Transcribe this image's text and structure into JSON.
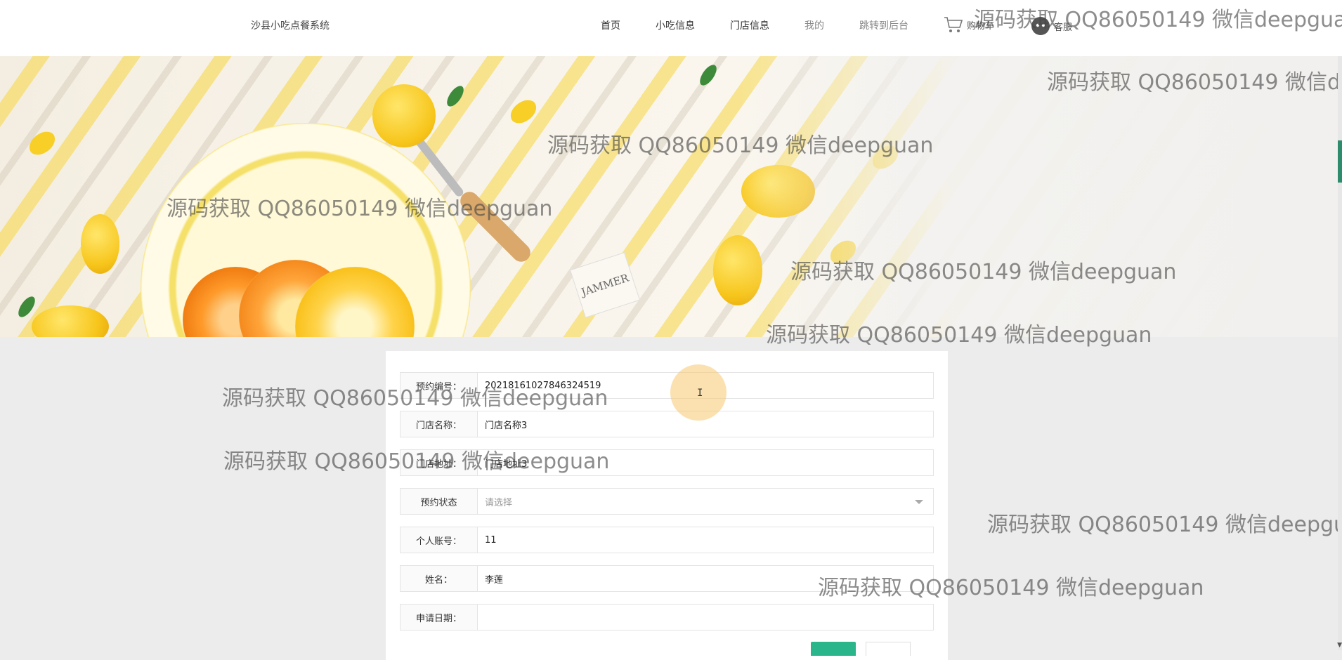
{
  "header": {
    "brand": "沙县小吃点餐系统",
    "nav": [
      "首页",
      "小吃信息",
      "门店信息",
      "我的",
      "跳转到后台"
    ],
    "cart_label": "购物车",
    "service_label": "客服"
  },
  "banner": {
    "tag_text": "JAMMER"
  },
  "form": {
    "fields": [
      {
        "label": "预约编号：",
        "value": "20218161027846324519"
      },
      {
        "label": "门店名称：",
        "value": "门店名称3"
      },
      {
        "label": "门店地址：",
        "value": "门店地址3"
      },
      {
        "label": "预约状态",
        "placeholder": "请选择"
      },
      {
        "label": "个人账号：",
        "value": "11"
      },
      {
        "label": "姓名：",
        "value": "李莲"
      },
      {
        "label": "申请日期：",
        "value": ""
      }
    ]
  },
  "watermark": "源码获取 QQ86050149 微信deepguan",
  "cursor": "I",
  "colors": {
    "primary_button": "#2bb58a",
    "page_background": "#ececec",
    "scroll_thumb": "#2e8b6b"
  }
}
